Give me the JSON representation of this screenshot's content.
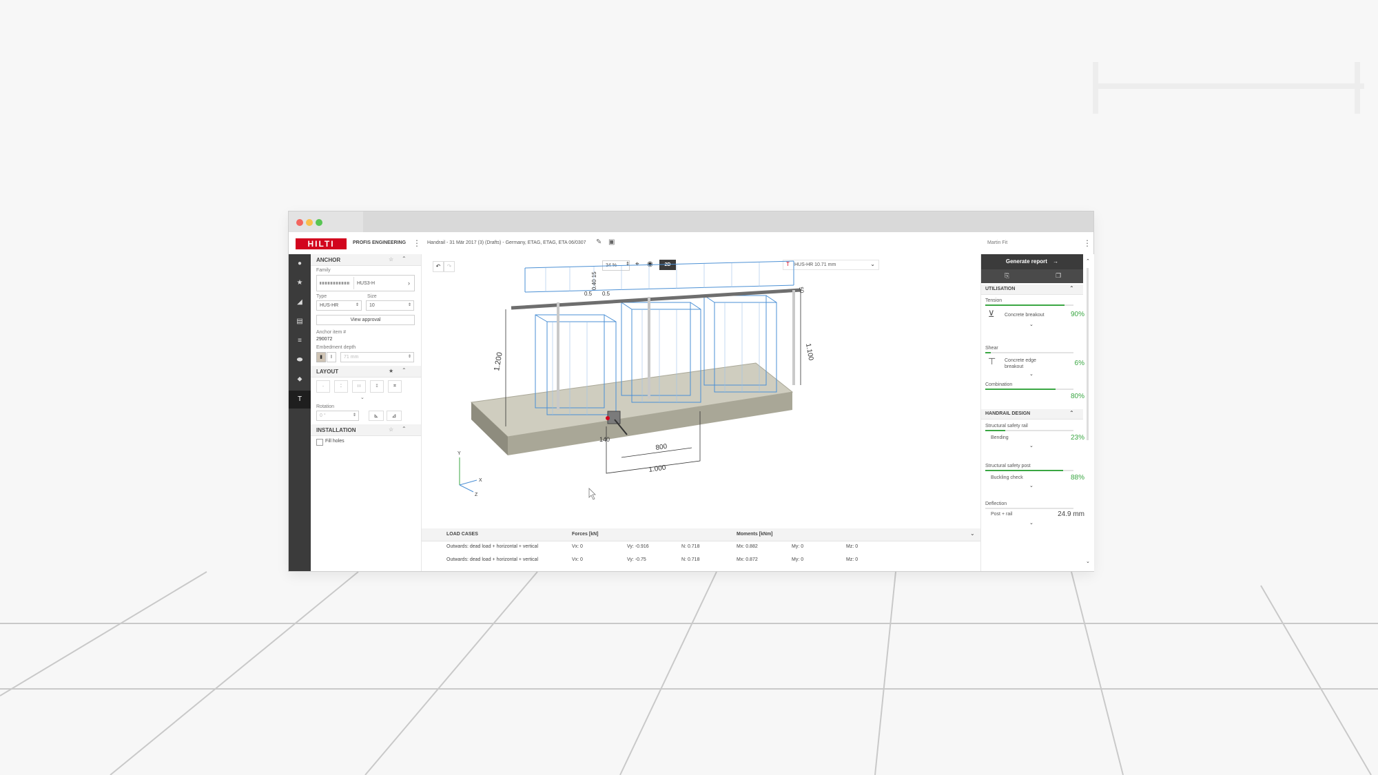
{
  "app": {
    "brand": "HILTI",
    "product": "PROFIS ENGINEERING",
    "project_title": "Handrail - 31 Mär 2017 (3) (Drafts) - Germany, ETAG, ETAG, ETA 06/0307",
    "user": "Martin Fit"
  },
  "left_panel": {
    "anchor": {
      "title": "ANCHOR",
      "family_label": "Family",
      "family_value": "HUS3-H",
      "type_label": "Type",
      "type_value": "HUS-HR",
      "size_label": "Size",
      "size_value": "10",
      "view_approval": "View approval",
      "item_label": "Anchor item #",
      "item_value": "290072",
      "embedment_label": "Embedment depth",
      "embedment_value": "71 mm"
    },
    "layout": {
      "title": "LAYOUT",
      "rotation_label": "Rotation",
      "rotation_value": "0 °"
    },
    "installation": {
      "title": "INSTALLATION",
      "fill_holes": "Fill holes"
    }
  },
  "viewport": {
    "zoom": "34 %",
    "view_mode": "2D",
    "anchor_selector": "HUS-HR 10.71 mm",
    "dimensions": [
      "1.200",
      "800",
      "1.000",
      "1.100",
      "140",
      "50",
      "0.5",
      "0.5",
      "0.40 15"
    ],
    "axes": {
      "y": "Y",
      "x": "X",
      "z": "Z"
    }
  },
  "load_cases": {
    "header": {
      "title": "LOAD CASES",
      "forces": "Forces [kN]",
      "moments": "Moments [kNm]"
    },
    "rows": [
      {
        "name": "Outwards: dead load + horizontal + vertical",
        "vx": "Vx: 0",
        "vy": "Vy: -0.916",
        "n": "N: 0.718",
        "mx": "Mx: 0.882",
        "my": "My: 0",
        "mz": "Mz: 0"
      },
      {
        "name": "Outwards: dead load + horizontal + vertical",
        "vx": "Vx: 0",
        "vy": "Vy: -0.75",
        "n": "N: 0.718",
        "mx": "Mx: 0.872",
        "my": "My: 0",
        "mz": "Mz: 0"
      }
    ]
  },
  "right_panel": {
    "generate_report": "Generate report",
    "utilisation": {
      "title": "UTILISATION",
      "tension_label": "Tension",
      "tension_item": "Concrete breakout",
      "tension_pct": "90%",
      "tension_value": 0.9,
      "shear_label": "Shear",
      "shear_item_line1": "Concrete edge",
      "shear_item_line2": "breakout",
      "shear_pct": "6%",
      "shear_value": 0.06,
      "combination_label": "Combination",
      "combination_pct": "80%",
      "combination_value": 0.8
    },
    "handrail": {
      "title": "HANDRAIL DESIGN",
      "rail_label": "Structural safety rail",
      "rail_item": "Bending",
      "rail_pct": "23%",
      "rail_value": 0.23,
      "post_label": "Structural safety post",
      "post_item": "Buckling check",
      "post_pct": "88%",
      "post_value": 0.88,
      "deflection_label": "Deflection",
      "deflection_item": "Post + rail",
      "deflection_value": "24.9 mm"
    }
  },
  "colors": {
    "brand_red": "#d2051e",
    "ok_green": "#39a642",
    "rail_dark": "#3b3b3b",
    "rebar_blue": "#4a8fd4"
  }
}
